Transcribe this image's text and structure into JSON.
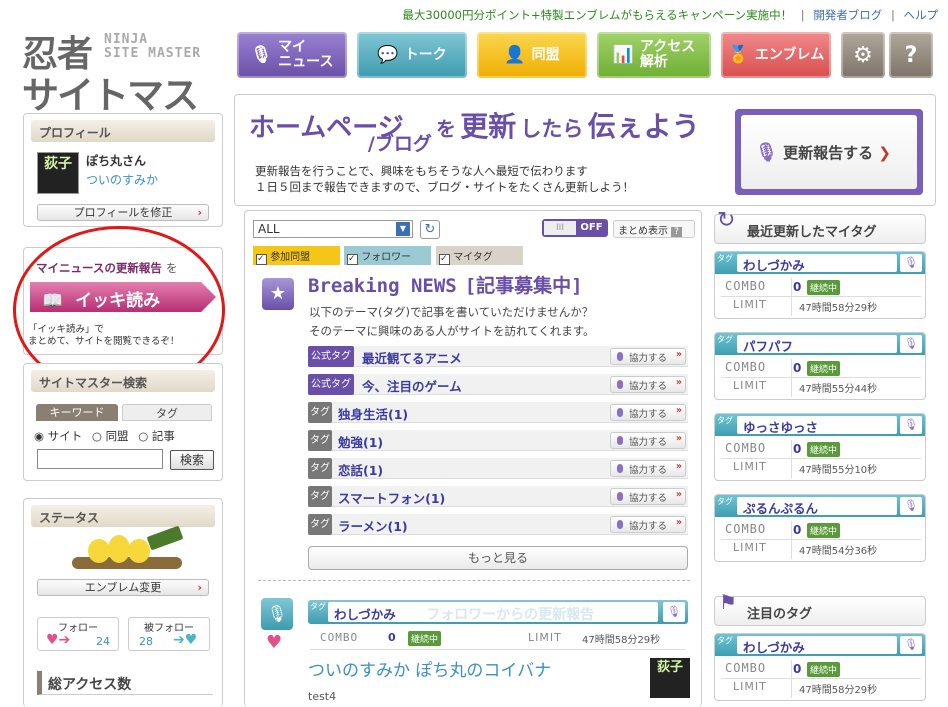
{
  "banner": {
    "campaign": "最大30000円分ポイント+特製エンブレムがもらえるキャンペーン実施中！",
    "sep1": "|",
    "dev_blog": "開発者ブログ",
    "sep2": "|",
    "help": "ヘルプ"
  },
  "logo": {
    "line1": "忍者",
    "line2": "サイトマスター",
    "en1": "NINJA",
    "en2": "SITE MASTER"
  },
  "nav": [
    {
      "label1": "マイ",
      "label2": "ニュース",
      "icon": "mic-icon",
      "color": "#7a5fb8"
    },
    {
      "label1": "トーク",
      "label2": "",
      "icon": "chat-icon",
      "color": "#4fa6b8"
    },
    {
      "label1": "同盟",
      "label2": "",
      "icon": "person-icon",
      "color": "#f2b814"
    },
    {
      "label1": "アクセス",
      "label2": "解析",
      "icon": "chart-icon",
      "color": "#79b843"
    },
    {
      "label1": "エンブレム",
      "label2": "",
      "icon": "emblem-icon",
      "color": "#e06262"
    },
    {
      "label1": "⚙",
      "label2": "",
      "icon": "gear-icon",
      "color": "#8a7f73"
    },
    {
      "label1": "?",
      "label2": "",
      "icon": "help-icon",
      "color": "#8a7f73"
    }
  ],
  "profile": {
    "heading": "プロフィール",
    "name": "ぽち丸さん",
    "link": "ついのすみか",
    "edit": "プロフィールを修正",
    "avatar_char": "荻子"
  },
  "ikki": {
    "lead": "マイニュースの更新報告",
    "lead_suffix": "を",
    "button": "イッキ読み",
    "desc1": "「イッキ読み」で",
    "desc2": "まとめて、サイトを閲覧できるぞ！"
  },
  "search": {
    "heading": "サイトマスター検索",
    "tab_keyword": "キーワード",
    "tab_tag": "タグ",
    "radio_site": "サイト",
    "radio_domei": "同盟",
    "radio_article": "記事",
    "submit": "検索"
  },
  "status": {
    "heading": "ステータス",
    "emblem_change": "エンブレム変更",
    "follow_label": "フォロー",
    "follow_count": "24",
    "follower_label": "被フォロー",
    "follower_count": "28",
    "total_access": "総アクセス数"
  },
  "hero": {
    "title_a": "ホームページ",
    "title_b": "/ブログ",
    "title_c": "を",
    "title_d": "更新",
    "title_e": "したら",
    "title_f": "伝ぇよう",
    "sub1": "更新報告を行うことで、興味をもちそうな人へ最短で伝わります",
    "sub2": "１日５回まで報告できますので、ブログ・サイトをたくさん更新しよう！",
    "report_button": "更新報告する"
  },
  "feed": {
    "filter_value": "ALL",
    "toggle_on": "III",
    "toggle_off": "OFF",
    "summary": "まとめ表示",
    "summary_q": "?",
    "chk_domei": "参加同盟",
    "chk_follower": "フォロワー",
    "chk_mytag": "マイタグ",
    "breaking_title": "Breaking NEWS",
    "breaking_sub": "[記事募集中]",
    "breaking_desc1": "以下のテーマ(タグ)で記事を書いていただけませんか？",
    "breaking_desc2": "そのテーマに興味のある人がサイトを訪れてくれます。",
    "help_label": "協力する",
    "tags": [
      {
        "kind": "公式タグ",
        "name": "最近観てるアニメ"
      },
      {
        "kind": "公式タグ",
        "name": "今、注目のゲーム"
      },
      {
        "kind": "タグ",
        "name": "独身生活(1)"
      },
      {
        "kind": "タグ",
        "name": "勉強(1)"
      },
      {
        "kind": "タグ",
        "name": "恋話(1)"
      },
      {
        "kind": "タグ",
        "name": "スマートフォン(1)"
      },
      {
        "kind": "タグ",
        "name": "ラーメン(1)"
      }
    ],
    "more": "もっと見る",
    "post": {
      "tag_kind": "タグ",
      "tag_name": "わしづかみ",
      "tag_note": "フォロワーからの更新報告",
      "combo": "COMBO",
      "combo_val": "0",
      "keizoku": "継続中",
      "limit": "LIMIT",
      "limit_val": "47時間58分29秒",
      "title": "ついのすみか ぽち丸のコイバナ",
      "body": "test4"
    }
  },
  "recent": {
    "heading": "最近更新したマイタグ",
    "tag_kind": "タグ",
    "combo": "COMBO",
    "keizoku": "継続中",
    "limit": "LIMIT",
    "items": [
      {
        "name": "わしづかみ",
        "combo": "0",
        "limit": "47時間58分29秒"
      },
      {
        "name": "パフパフ",
        "combo": "0",
        "limit": "47時間55分44秒"
      },
      {
        "name": "ゆっさゆっさ",
        "combo": "0",
        "limit": "47時間55分10秒"
      },
      {
        "name": "ぷるんぷるん",
        "combo": "0",
        "limit": "47時間54分36秒"
      }
    ]
  },
  "featured": {
    "heading": "注目のタグ",
    "tag_kind": "タグ",
    "combo": "COMBO",
    "keizoku": "継続中",
    "limit": "LIMIT",
    "item": {
      "name": "わしづかみ",
      "combo": "0",
      "limit": "47時間58分29秒"
    }
  }
}
